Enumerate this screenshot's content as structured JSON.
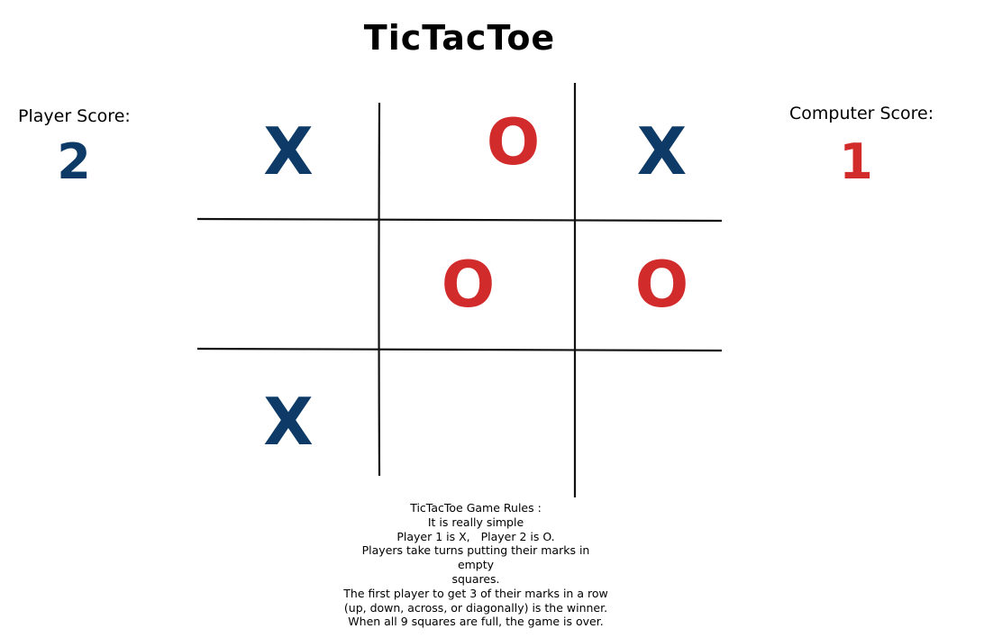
{
  "title": "TicTacToe",
  "player": {
    "label": "Player Score:",
    "score": "2"
  },
  "computer": {
    "label": "Computer Score:",
    "score": "1"
  },
  "colors": {
    "x": "#0d3a66",
    "o": "#d22b2b",
    "grid": "#111111"
  },
  "board": [
    [
      "X",
      "O",
      "X"
    ],
    [
      "",
      "O",
      "O"
    ],
    [
      "X",
      "",
      ""
    ]
  ],
  "rules": [
    "TicTacToe Game Rules :",
    "It is really simple",
    "Player 1 is X,   Player 2 is O.",
    "Players take turns putting their marks in empty",
    "squares.",
    "The first player to get 3 of their marks in a row",
    "(up, down, across, or diagonally) is the winner.",
    "When all 9 squares are full, the game is over."
  ]
}
